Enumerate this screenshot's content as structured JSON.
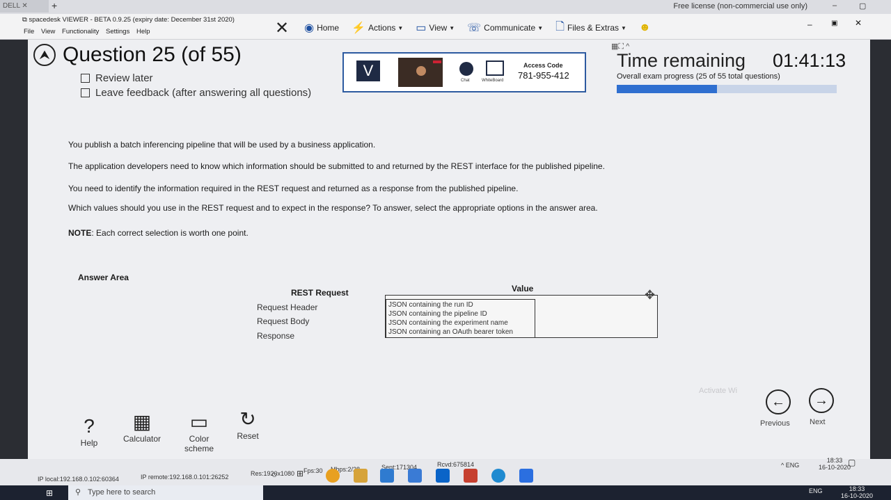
{
  "browser": {
    "tab_label": "DELL",
    "notice": "Free license (non-commercial use only)"
  },
  "viewer": {
    "title": "spacedesk VIEWER - BETA 0.9.25 (expiry date: December 31st 2020)",
    "menu": [
      "File",
      "View",
      "Functionality",
      "Settings",
      "Help"
    ],
    "toolbar": {
      "home": "Home",
      "actions": "Actions",
      "view": "View",
      "communicate": "Communicate",
      "files": "Files & Extras"
    }
  },
  "question": {
    "title": "Question 25 (of 55)",
    "review_later": "Review later",
    "leave_feedback": "Leave feedback (after answering all questions)",
    "lines": [
      "You publish a batch inferencing pipeline that will be used by a business application.",
      "The application developers need to know which information should be submitted to and returned by the REST interface for the published pipeline.",
      "You need to identify the information required in the REST request and returned as a response from the published pipeline.",
      "Which values should you use in the REST request and to expect in the response? To answer, select the appropriate options in the answer area."
    ],
    "note_label": "NOTE",
    "note_text": ": Each correct selection is worth one point."
  },
  "session": {
    "chat_label": "Chat",
    "whiteboard_label": "WhiteBoard",
    "access_label": "Access Code",
    "access_code": "781-955-412"
  },
  "timer": {
    "label": "Time remaining",
    "value": "01:41:13",
    "progress_text": "Overall exam progress (25 of 55 total questions)",
    "progress_fraction": 0.4545
  },
  "answer": {
    "area_label": "Answer Area",
    "rest_header": "REST Request",
    "value_header": "Value",
    "rows": [
      "Request Header",
      "Request Body",
      "Response"
    ],
    "options": [
      "JSON containing the run ID",
      "JSON containing the pipeline ID",
      "JSON containing the experiment name",
      "JSON containing an OAuth bearer token"
    ]
  },
  "tools": {
    "help": "Help",
    "calculator": "Calculator",
    "color_scheme": "Color scheme",
    "reset": "Reset",
    "previous": "Previous",
    "next": "Next"
  },
  "status": {
    "ip_local": "IP local:192.168.0.102:60364",
    "ip_remote": "IP remote:192.168.0.101:26252",
    "res": "Res:1920x1080",
    "fps": "Fps:30",
    "mbps": "Mbps:2/28",
    "sent": "Sent:171304",
    "rcvd": "Rcvd:675814",
    "lang": "ENG",
    "time": "18:33",
    "date": "16-10-2020"
  },
  "windows": {
    "search_placeholder": "Type here to search",
    "lang": "ENG",
    "time": "18:33",
    "date": "16-10-2020"
  }
}
